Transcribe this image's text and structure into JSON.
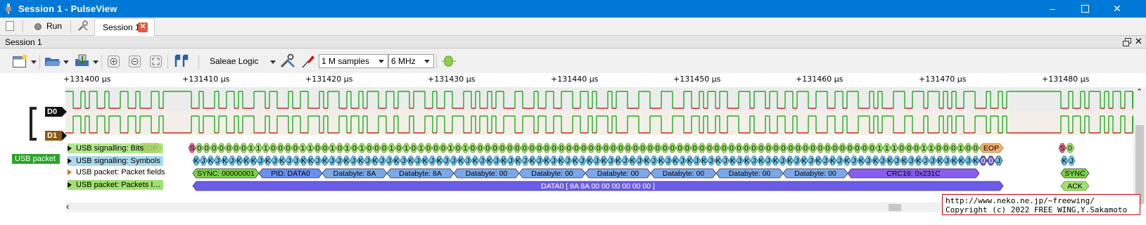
{
  "window": {
    "title": "Session 1 - PulseView"
  },
  "tabbar": {
    "run_label": "Run",
    "session_tab_label": "Session 1"
  },
  "session_header": {
    "label": "Session 1"
  },
  "toolbar": {
    "device": "Saleae Logic",
    "sample_count": "1 M samples",
    "sample_rate": "6 MHz"
  },
  "ruler": {
    "ticks": [
      "+131400 µs",
      "+131410 µs",
      "+131420 µs",
      "+131430 µs",
      "+131440 µs",
      "+131450 µs",
      "+131460 µs",
      "+131470 µs",
      "+131480 µs"
    ]
  },
  "channels": {
    "d0": "D0",
    "d1": "D1"
  },
  "group": {
    "label": "USB packet"
  },
  "decoder_rows": {
    "bits": "USB signalling: Bits",
    "symbols": "USB signalling: Symbols",
    "packet_fields": "USB packet: Packet fields",
    "packets": "USB packet: Packets I…"
  },
  "annotations": {
    "eop_left": "EOP",
    "eop_right": "EOP",
    "bits_left_partial": "S",
    "bits_right": "S 0",
    "bits_string": "0 0 0 0 0 0 0 1 1 1 0 0 0 0 1 1 0 0 1 0 1 0 1 0 0 0 1 0 1 0 1 0 0 0 1 0 1 0 0 0 0 0 0 0 0 0 0 0 0 0 0 0 0 0 0 0 0 0 0 0 0 0 0 0 0 0 0 0 0 0 0 0 0 0 0 0 0 0 0 0 0 0 0 0 0 0 0 0 0 0 0 0 1 1 1 0 0 0 1 1 0 0 0 1 0 0",
    "symbols_string": "K J K J K J K K K J K J K J J K K J K J J K J K J K J J K J K J K J K J J K J K J K J K J K J K J K J K J K J K J K J K J K J K J K J K J K J K J K J K J K J K J K J K J K J K J K J K J K J K J K J K J K J J K J K K J K",
    "symbols_tail": "0 0 J",
    "symbols_right": "K J",
    "fields": [
      {
        "label": "SYNC: 00000001",
        "color": "#7fd34a"
      },
      {
        "label": "PID: DATA0",
        "color": "#6b8ff0"
      },
      {
        "label": "Databyte: 8A",
        "color": "#7aa8ea"
      },
      {
        "label": "Databyte: 8A",
        "color": "#7aa8ea"
      },
      {
        "label": "Databyte: 00",
        "color": "#7aa8ea"
      },
      {
        "label": "Databyte: 00",
        "color": "#7aa8ea"
      },
      {
        "label": "Databyte: 00",
        "color": "#7aa8ea"
      },
      {
        "label": "Databyte: 00",
        "color": "#7aa8ea"
      },
      {
        "label": "Databyte: 00",
        "color": "#7aa8ea"
      },
      {
        "label": "Databyte: 00",
        "color": "#7aa8ea"
      },
      {
        "label": "CRC16: 0x231C",
        "color": "#8a5cf0"
      }
    ],
    "sync_right": "SYNC",
    "packet_label": "DATA0 [ 8A 8A 00 00 00 00 00 00 ]",
    "ack_label": "ACK"
  },
  "copyright": {
    "line1": "http://www.neko.ne.jp/~freewing/",
    "line2": "Copyright (c) 2022 FREE WING,Y.Sakamoto"
  },
  "colors": {
    "titlebar": "#0078d7",
    "trace_high": "#00a000",
    "trace_low": "#cc0000",
    "group": "#2aa32a",
    "eop": "#f0b070",
    "bits": "#a0e070",
    "symbols": "#6fc0e0",
    "packet": "#6b5ce8"
  }
}
